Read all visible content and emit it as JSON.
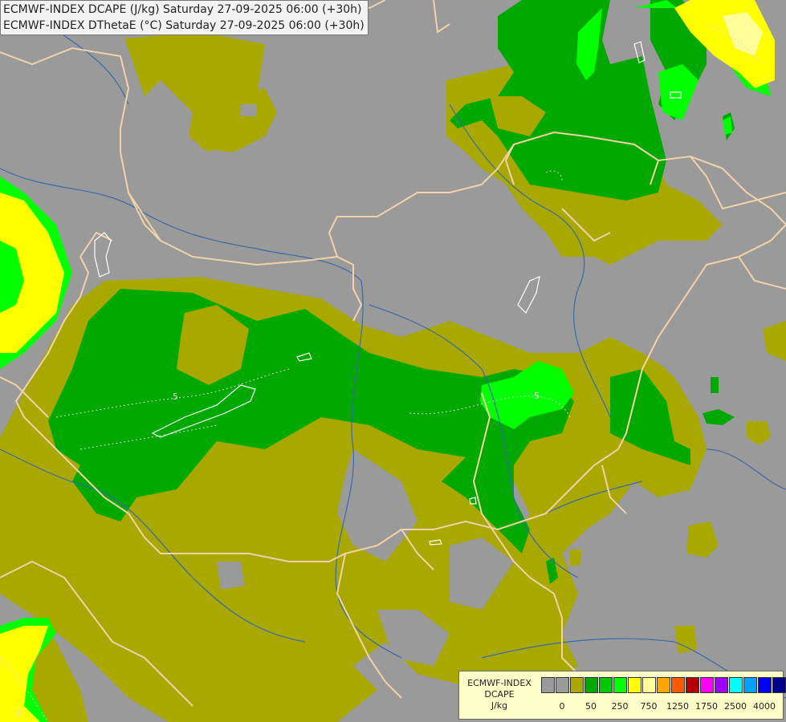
{
  "title": {
    "line1": "ECMWF-INDEX DCAPE (J/kg) Saturday 27-09-2025 06:00 (+30h)",
    "line2": "ECMWF-INDEX DThetaE (°C) Saturday 27-09-2025 06:00 (+30h)"
  },
  "map": {
    "contour_labels": [
      "5",
      "5",
      "5"
    ],
    "colors": {
      "background": "#9a9a9a",
      "olive": "#a8a800",
      "green": "#00a800",
      "bright_green": "#00ff00",
      "yellow": "#ffff00",
      "pale_yellow": "#ffff99",
      "border": "#f2d2a8",
      "river": "#3a6aa8"
    }
  },
  "legend": {
    "line1": "ECMWF-INDEX",
    "line2": "DCAPE",
    "line3": "J/kg",
    "swatch_colors": [
      "#9a9a9a",
      "#9a9a9a",
      "#a8a800",
      "#00a800",
      "#00c800",
      "#00ff00",
      "#ffff00",
      "#ffff99",
      "#ffa500",
      "#ff5a00",
      "#b40000",
      "#ff00ff",
      "#a000ff",
      "#00ffff",
      "#00a0ff",
      "#0000ff",
      "#000090"
    ],
    "ticks": [
      "0",
      "50",
      "250",
      "750",
      "1250",
      "1750",
      "2500",
      "4000"
    ]
  }
}
